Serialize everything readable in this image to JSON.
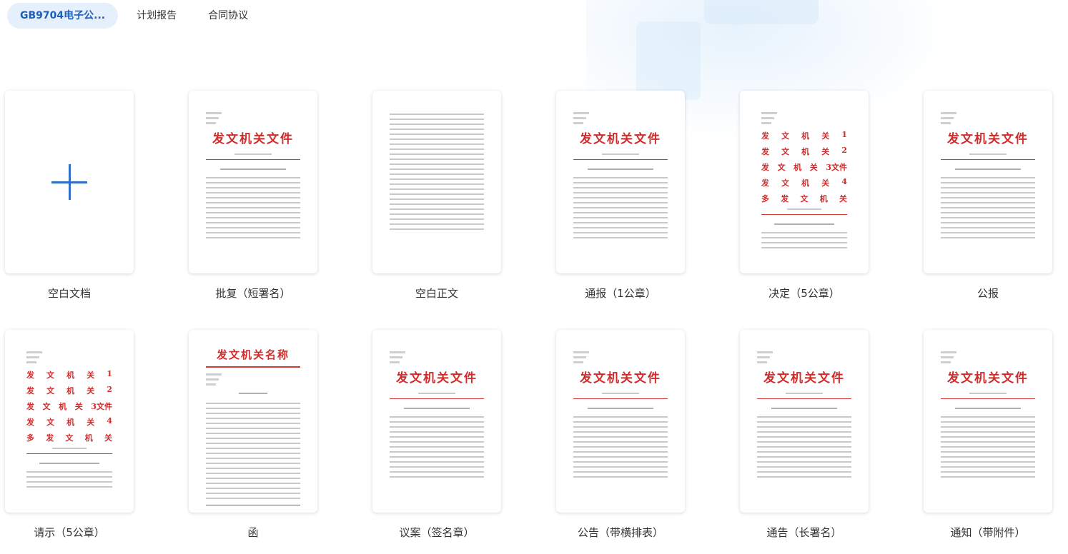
{
  "tabs": [
    {
      "label": "GB9704电子公...",
      "active": true
    },
    {
      "label": "计划报告",
      "active": false
    },
    {
      "label": "合同协议",
      "active": false
    }
  ],
  "templates": [
    {
      "label": "空白文档",
      "kind": "blank"
    },
    {
      "label": "批复（短署名）",
      "kind": "header"
    },
    {
      "label": "空白正文",
      "kind": "body"
    },
    {
      "label": "通报（1公章）",
      "kind": "header"
    },
    {
      "label": "决定（5公章）",
      "kind": "multi"
    },
    {
      "label": "公报",
      "kind": "header"
    },
    {
      "label": "请示（5公章）",
      "kind": "multi"
    },
    {
      "label": "函",
      "kind": "letter"
    },
    {
      "label": "议案（签名章）",
      "kind": "header"
    },
    {
      "label": "公告（带横排表）",
      "kind": "header"
    },
    {
      "label": "通告（长署名）",
      "kind": "header"
    },
    {
      "label": "通知（带附件）",
      "kind": "header"
    }
  ],
  "thumbnail_text": {
    "doc_title": "发文机关文件",
    "letter_title": "发文机关名称",
    "multi_rows": [
      [
        "发",
        "文",
        "机",
        "关",
        "1"
      ],
      [
        "发",
        "文",
        "机",
        "关",
        "2"
      ],
      [
        "发",
        "文",
        "机",
        "关",
        "3文件"
      ],
      [
        "发",
        "文",
        "机",
        "关",
        "4"
      ],
      [
        "多",
        "发",
        "文",
        "机",
        "关"
      ]
    ]
  },
  "colors": {
    "accent": "#1d5fb8",
    "red": "#d22b2b"
  }
}
